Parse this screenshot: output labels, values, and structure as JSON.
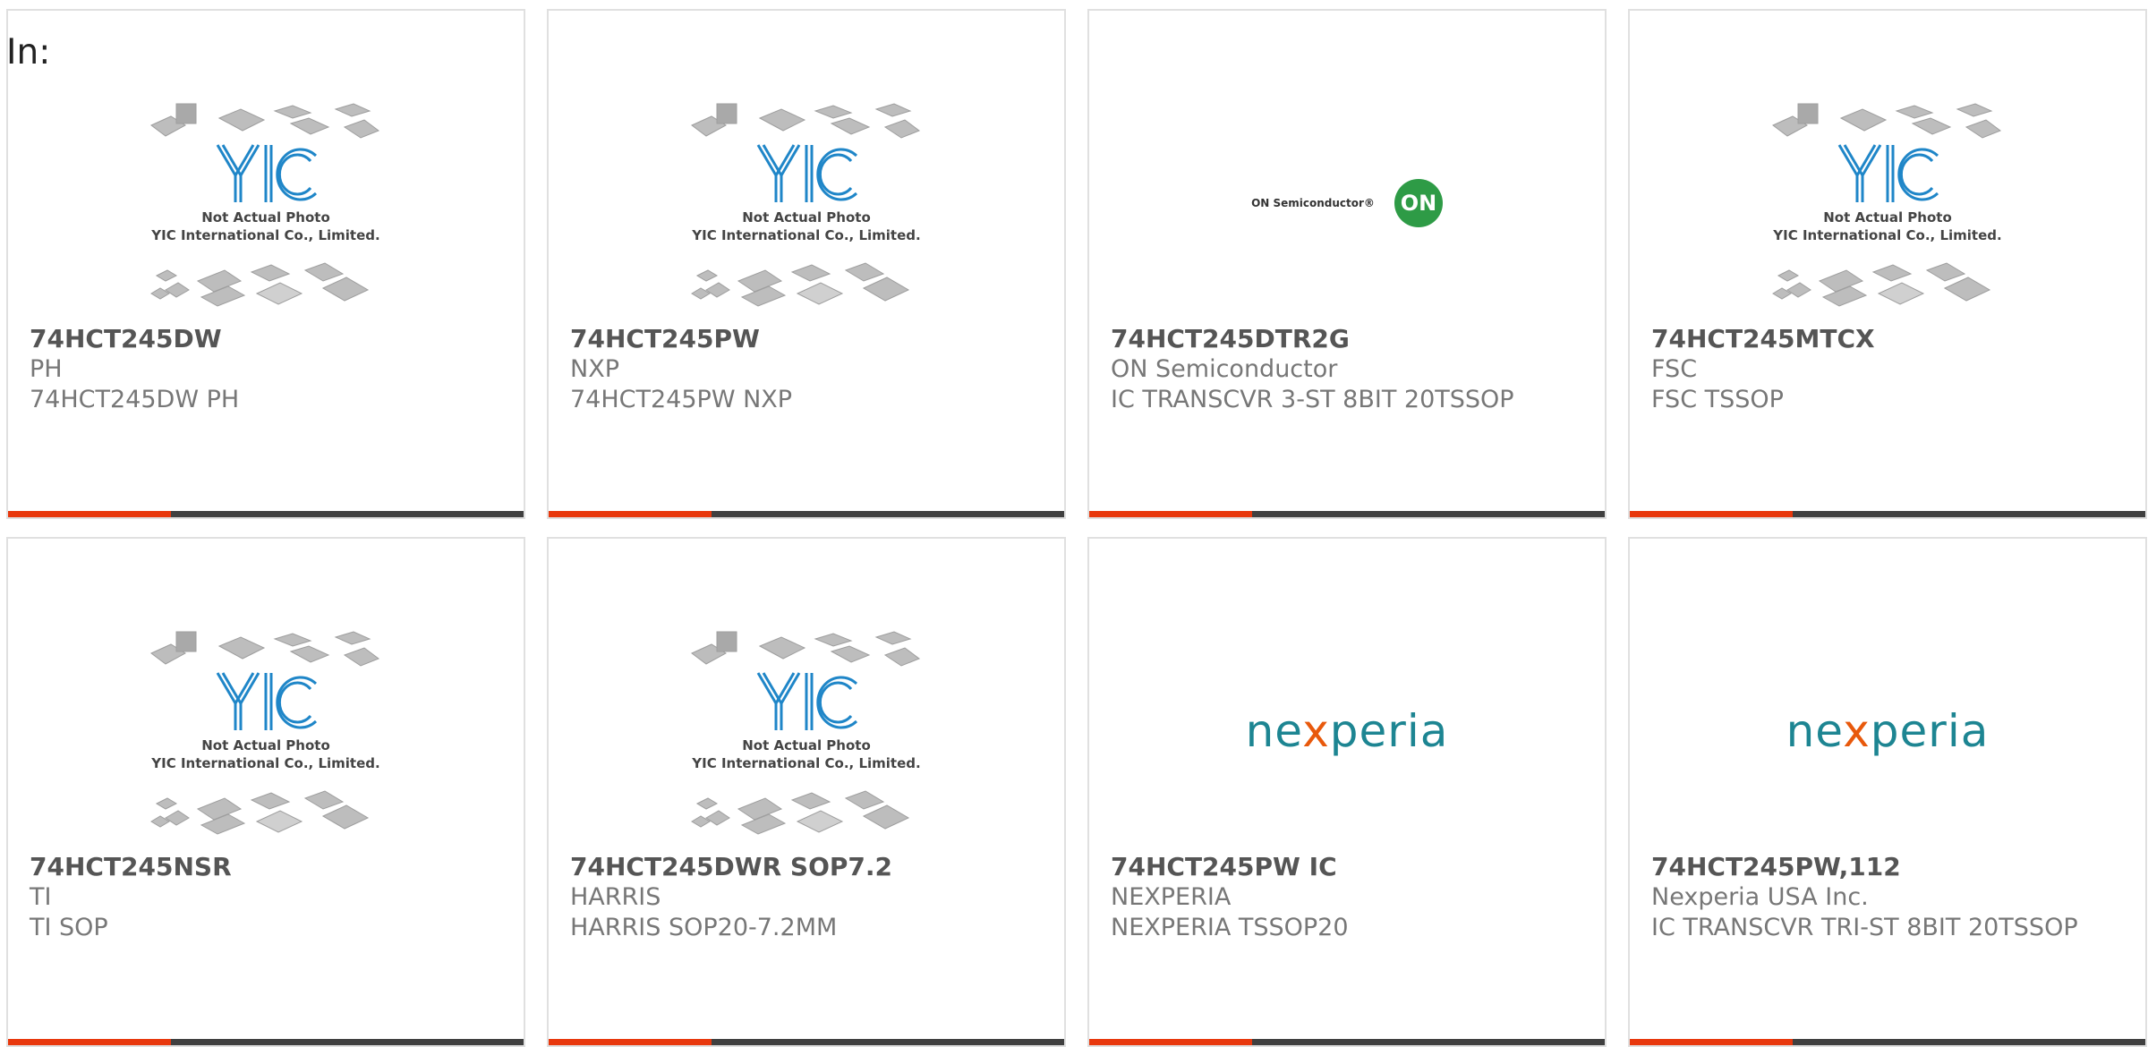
{
  "header": {
    "label": "In:"
  },
  "colors": {
    "accent": "#e8380d",
    "bar": "#404040",
    "nexperia_teal": "#1d8592",
    "on_green": "#2e9b46"
  },
  "logos": {
    "yic": {
      "icon": "yic-placeholder-icon",
      "line1": "Not Actual Photo",
      "line2": "YIC International Co., Limited.",
      "brand": "YIC"
    },
    "on": {
      "icon": "on-semiconductor-logo",
      "text": "ON Semiconductor®",
      "badge": "ON"
    },
    "nexperia": {
      "icon": "nexperia-logo",
      "pre": "ne",
      "x": "x",
      "post": "peria"
    }
  },
  "products": [
    {
      "part_number": "74HCT245DW",
      "manufacturer": "PH",
      "description": "74HCT245DW PH",
      "logo": "yic"
    },
    {
      "part_number": "74HCT245PW",
      "manufacturer": "NXP",
      "description": "74HCT245PW NXP",
      "logo": "yic"
    },
    {
      "part_number": "74HCT245DTR2G",
      "manufacturer": "ON Semiconductor",
      "description": "IC TRANSCVR 3-ST 8BIT 20TSSOP",
      "logo": "on"
    },
    {
      "part_number": "74HCT245MTCX",
      "manufacturer": "FSC",
      "description": "FSC TSSOP",
      "logo": "yic"
    },
    {
      "part_number": "74HCT245NSR",
      "manufacturer": "TI",
      "description": "TI SOP",
      "logo": "yic"
    },
    {
      "part_number": "74HCT245DWR SOP7.2",
      "manufacturer": "HARRIS",
      "description": "HARRIS SOP20-7.2MM",
      "logo": "yic"
    },
    {
      "part_number": "74HCT245PW IC",
      "manufacturer": "NEXPERIA",
      "description": "NEXPERIA TSSOP20",
      "logo": "nexperia"
    },
    {
      "part_number": "74HCT245PW,112",
      "manufacturer": "Nexperia USA Inc.",
      "description": "IC TRANSCVR TRI-ST 8BIT 20TSSOP",
      "logo": "nexperia"
    }
  ]
}
